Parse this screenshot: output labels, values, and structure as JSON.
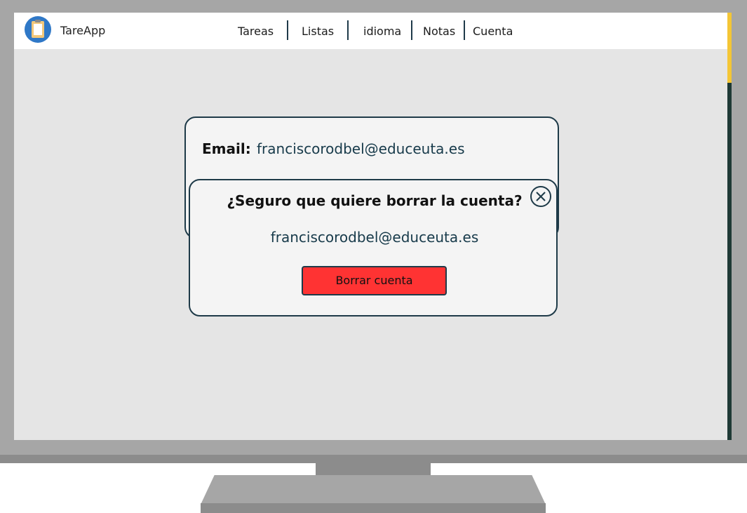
{
  "app": {
    "name": "TareApp"
  },
  "nav": {
    "items": [
      "Tareas",
      "Listas",
      "idioma",
      "Notas",
      "Cuenta"
    ]
  },
  "account": {
    "email_label": "Email:",
    "email_value": "franciscorodbel@educeuta.es"
  },
  "dialog": {
    "title": "¿Seguro que quiere borrar la cuenta?",
    "email": "franciscorodbel@educeuta.es",
    "delete_label": "Borrar cuenta",
    "close_icon": "close-icon"
  },
  "colors": {
    "accent_scroll": "#f4c636",
    "danger": "#ff3333",
    "border": "#1e3a48"
  }
}
